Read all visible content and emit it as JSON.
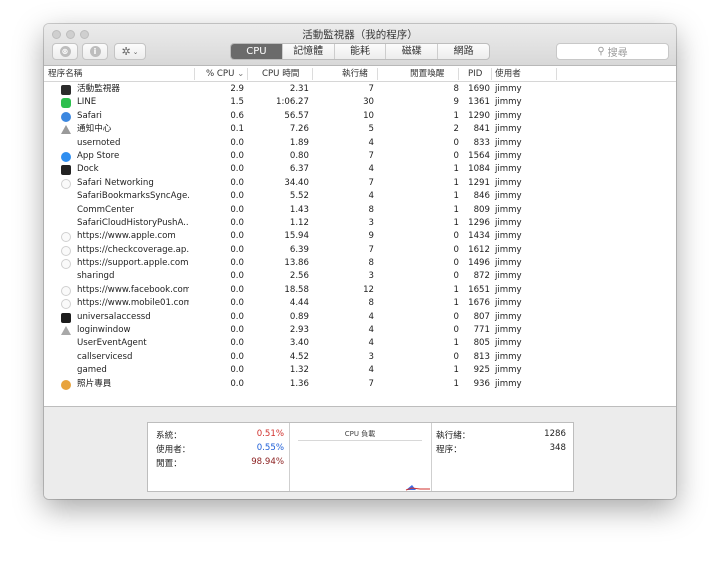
{
  "window": {
    "title": "活動監視器（我的程序）"
  },
  "toolbar": {
    "stop_glyph": "⊗",
    "info_glyph": "i",
    "gear_glyph": "✲",
    "chevron_glyph": "⌄",
    "search_placeholder": "搜尋",
    "search_glyph": "⚲"
  },
  "tabs": [
    {
      "label": "CPU",
      "active": true
    },
    {
      "label": "記憶體",
      "active": false
    },
    {
      "label": "能耗",
      "active": false
    },
    {
      "label": "磁碟",
      "active": false
    },
    {
      "label": "網路",
      "active": false
    }
  ],
  "columns": {
    "name": "程序名稱",
    "cpu": "% CPU",
    "sort_indicator": "⌄",
    "time": "CPU 時間",
    "threads": "執行緒",
    "wakeups": "閒置喚醒",
    "pid": "PID",
    "user": "使用者"
  },
  "processes": [
    {
      "name": "活動監視器",
      "icon": "activity-monitor-icon",
      "icon_color": "#2b2b2b",
      "cpu": "2.9",
      "time": "2.31",
      "threads": "7",
      "wakeups": "8",
      "pid": "1690",
      "user": "jimmy"
    },
    {
      "name": "LINE",
      "icon": "line-icon",
      "icon_color": "#2dbf4e",
      "cpu": "1.5",
      "time": "1:06.27",
      "threads": "30",
      "wakeups": "9",
      "pid": "1361",
      "user": "jimmy"
    },
    {
      "name": "Safari",
      "icon": "safari-icon",
      "icon_color": "#3b87e0",
      "cpu": "0.6",
      "time": "56.57",
      "threads": "10",
      "wakeups": "1",
      "pid": "1290",
      "user": "jimmy"
    },
    {
      "name": "通知中心",
      "icon": "notification-center-icon",
      "icon_color": "#9a9a9a",
      "cpu": "0.1",
      "time": "7.26",
      "threads": "5",
      "wakeups": "2",
      "pid": "841",
      "user": "jimmy"
    },
    {
      "name": "usernoted",
      "icon": "",
      "icon_color": "",
      "cpu": "0.0",
      "time": "1.89",
      "threads": "4",
      "wakeups": "0",
      "pid": "833",
      "user": "jimmy"
    },
    {
      "name": "App Store",
      "icon": "app-store-icon",
      "icon_color": "#2f8ef0",
      "cpu": "0.0",
      "time": "0.80",
      "threads": "7",
      "wakeups": "0",
      "pid": "1564",
      "user": "jimmy"
    },
    {
      "name": "Dock",
      "icon": "dock-icon",
      "icon_color": "#222222",
      "cpu": "0.0",
      "time": "6.37",
      "threads": "4",
      "wakeups": "1",
      "pid": "1084",
      "user": "jimmy"
    },
    {
      "name": "Safari Networking",
      "icon": "shield-icon",
      "icon_color": "shield",
      "cpu": "0.0",
      "time": "34.40",
      "threads": "7",
      "wakeups": "1",
      "pid": "1291",
      "user": "jimmy"
    },
    {
      "name": "SafariBookmarksSyncAge...",
      "icon": "",
      "icon_color": "",
      "cpu": "0.0",
      "time": "5.52",
      "threads": "4",
      "wakeups": "1",
      "pid": "846",
      "user": "jimmy"
    },
    {
      "name": "CommCenter",
      "icon": "",
      "icon_color": "",
      "cpu": "0.0",
      "time": "1.43",
      "threads": "8",
      "wakeups": "1",
      "pid": "809",
      "user": "jimmy"
    },
    {
      "name": "SafariCloudHistoryPushA...",
      "icon": "",
      "icon_color": "",
      "cpu": "0.0",
      "time": "1.12",
      "threads": "3",
      "wakeups": "1",
      "pid": "1296",
      "user": "jimmy"
    },
    {
      "name": "https://www.apple.com",
      "icon": "shield-icon",
      "icon_color": "shield",
      "cpu": "0.0",
      "time": "15.94",
      "threads": "9",
      "wakeups": "0",
      "pid": "1434",
      "user": "jimmy"
    },
    {
      "name": "https://checkcoverage.ap...",
      "icon": "shield-icon",
      "icon_color": "shield",
      "cpu": "0.0",
      "time": "6.39",
      "threads": "7",
      "wakeups": "0",
      "pid": "1612",
      "user": "jimmy"
    },
    {
      "name": "https://support.apple.com",
      "icon": "shield-icon",
      "icon_color": "shield",
      "cpu": "0.0",
      "time": "13.86",
      "threads": "8",
      "wakeups": "0",
      "pid": "1496",
      "user": "jimmy"
    },
    {
      "name": "sharingd",
      "icon": "",
      "icon_color": "",
      "cpu": "0.0",
      "time": "2.56",
      "threads": "3",
      "wakeups": "0",
      "pid": "872",
      "user": "jimmy"
    },
    {
      "name": "https://www.facebook.com",
      "icon": "shield-icon",
      "icon_color": "shield",
      "cpu": "0.0",
      "time": "18.58",
      "threads": "12",
      "wakeups": "1",
      "pid": "1651",
      "user": "jimmy"
    },
    {
      "name": "https://www.mobile01.com",
      "icon": "shield-icon",
      "icon_color": "shield",
      "cpu": "0.0",
      "time": "4.44",
      "threads": "8",
      "wakeups": "1",
      "pid": "1676",
      "user": "jimmy"
    },
    {
      "name": "universalaccessd",
      "icon": "universal-access-icon",
      "icon_color": "#1c1c1c",
      "cpu": "0.0",
      "time": "0.89",
      "threads": "4",
      "wakeups": "0",
      "pid": "807",
      "user": "jimmy"
    },
    {
      "name": "loginwindow",
      "icon": "loginwindow-icon",
      "icon_color": "#a8a8a8",
      "cpu": "0.0",
      "time": "2.93",
      "threads": "4",
      "wakeups": "0",
      "pid": "771",
      "user": "jimmy"
    },
    {
      "name": "UserEventAgent",
      "icon": "",
      "icon_color": "",
      "cpu": "0.0",
      "time": "3.40",
      "threads": "4",
      "wakeups": "1",
      "pid": "805",
      "user": "jimmy"
    },
    {
      "name": "callservicesd",
      "icon": "",
      "icon_color": "",
      "cpu": "0.0",
      "time": "4.52",
      "threads": "3",
      "wakeups": "0",
      "pid": "813",
      "user": "jimmy"
    },
    {
      "name": "gamed",
      "icon": "",
      "icon_color": "",
      "cpu": "0.0",
      "time": "1.32",
      "threads": "4",
      "wakeups": "1",
      "pid": "925",
      "user": "jimmy"
    },
    {
      "name": "照片專員",
      "icon": "photos-agent-icon",
      "icon_color": "#e8a33c",
      "cpu": "0.0",
      "time": "1.36",
      "threads": "7",
      "wakeups": "1",
      "pid": "936",
      "user": "jimmy"
    }
  ],
  "stats": {
    "system_label": "系統：",
    "system_value": "0.51%",
    "system_color": "#d0312d",
    "user_label": "使用者：",
    "user_value": "0.55%",
    "user_color": "#1e5fd8",
    "idle_label": "閒置：",
    "idle_value": "98.94%",
    "idle_color": "#8a1e1e",
    "chart_title": "CPU 負載",
    "threads_label": "執行緒：",
    "threads_value": "1286",
    "processes_label": "程序：",
    "processes_value": "348"
  }
}
